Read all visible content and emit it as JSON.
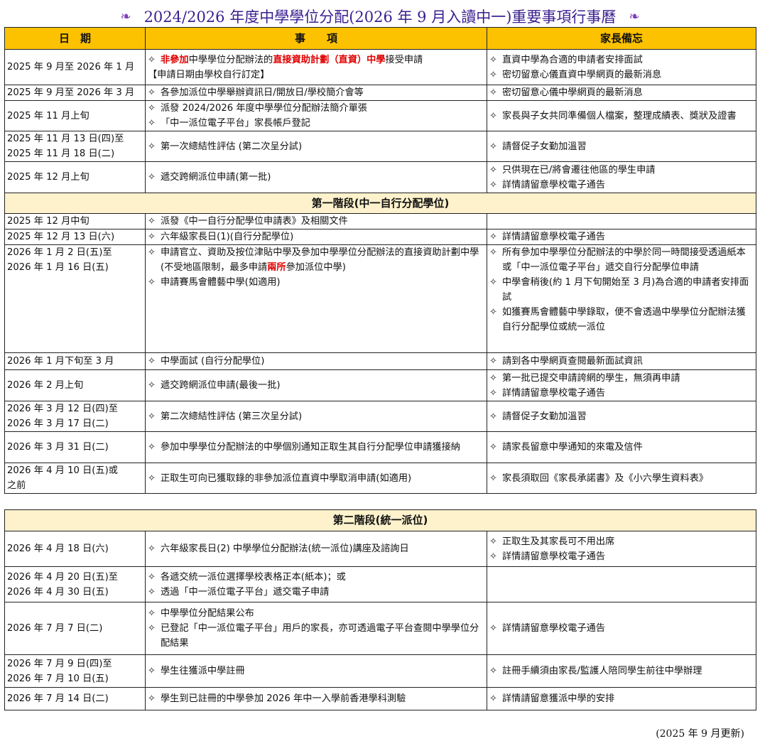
{
  "title": "2024/2026 年度中學學位分配(2026 年 9 月入讀中一)重要事項行事曆",
  "ornament_left": "ঌ",
  "ornament_right": "ঌ",
  "header": {
    "date": "日　期",
    "item": "事　　項",
    "note": "家長備忘"
  },
  "bullet": "✧",
  "rows1": [
    {
      "date": "2025 年 9 月至 2026 年 1 月",
      "items": [
        {
          "parts": [
            {
              "t": "非參加",
              "c": "red"
            },
            {
              "t": "中學學位分配辦法的"
            },
            {
              "t": "直接資助計劃（直資）中學",
              "c": "red"
            },
            {
              "t": "接受申請"
            }
          ]
        },
        {
          "nobullet": true,
          "parts": [
            {
              "t": "【申請日期由學校自行訂定】"
            }
          ]
        }
      ],
      "notes": [
        "直資中學為合適的申請者安排面試",
        "密切留意心儀直資中學網頁的最新消息"
      ]
    },
    {
      "date": "2025 年 9 月至 2026 年 3 月",
      "items": [
        {
          "parts": [
            {
              "t": "各參加派位中學舉辦資訊日/開放日/學校簡介會等"
            }
          ]
        }
      ],
      "notes": [
        "密切留意心儀中學網頁的最新消息"
      ]
    },
    {
      "date": "2025 年 11 月上旬",
      "items": [
        {
          "parts": [
            {
              "t": "派發 2024/2026 年度中學學位分配辦法簡介單張"
            }
          ]
        },
        {
          "parts": [
            {
              "t": "「中一派位電子平台」家長帳戶登記"
            }
          ]
        }
      ],
      "notes": [
        "家長與子女共同準備個人檔案，整理成績表、獎狀及證書"
      ]
    },
    {
      "date": "2025 年 11 月 13 日(四)至\n2025 年 11 月 18 日(二)",
      "items": [
        {
          "parts": [
            {
              "t": "第一次總結性評估 (第二次呈分試)"
            }
          ]
        }
      ],
      "notes": [
        "請督促子女勤加溫習"
      ]
    },
    {
      "date": "2025 年 12 月上旬",
      "items": [
        {
          "parts": [
            {
              "t": "遞交跨網派位申請(第一批)"
            }
          ]
        }
      ],
      "notes": [
        "只供現在已/將會遷往他區的學生申請",
        "詳情請留意學校電子通告"
      ]
    }
  ],
  "stage1": "第一階段(中一自行分配學位)",
  "rows2": [
    {
      "date": "2025 年 12 月中旬",
      "items": [
        {
          "parts": [
            {
              "t": "派發《中一自行分配學位申請表》及相關文件"
            }
          ]
        }
      ],
      "notes": []
    },
    {
      "date": "2025 年 12 月 13 日(六)",
      "items": [
        {
          "parts": [
            {
              "t": "六年級家長日(1)(自行分配學位)"
            }
          ]
        }
      ],
      "notes": [
        "詳情請留意學校電子通告"
      ]
    },
    {
      "date": "2026 年 1 月 2 日(五)至\n2026 年 1 月 16 日(五)",
      "top": true,
      "items": [
        {
          "parts": [
            {
              "t": "申請官立、資助及按位津貼中學及參加中學學位分配辦法的直接資助計劃中學(不受地區限制，最多申請"
            },
            {
              "t": "兩所",
              "c": "red"
            },
            {
              "t": "參加派位中學)"
            }
          ]
        },
        {
          "parts": [
            {
              "t": "申請賽馬會體藝中學(如適用)"
            }
          ]
        }
      ],
      "notes": [
        "所有參加中學學位分配辦法的中學於同一時間接受透過紙本或「中一派位電子平台」遞交自行分配學位申請",
        "中學會稍後(約 1 月下旬開始至 3 月)為合適的申請者安排面試",
        "如獲賽馬會體藝中學錄取，便不會透過中學學位分配辦法獲自行分配學位或統一派位"
      ]
    },
    {
      "date": "2026 年 1 月下旬至 3 月",
      "items": [
        {
          "parts": [
            {
              "t": "中學面試 (自行分配學位)"
            }
          ]
        }
      ],
      "notes": [
        "請到各中學網頁查閱最新面試資訊"
      ]
    },
    {
      "date": "2026 年 2 月上旬",
      "items": [
        {
          "parts": [
            {
              "t": "遞交跨網派位申請(最後一批)"
            }
          ]
        }
      ],
      "notes": [
        "第一批已提交申請誇網的學生，無須再申請",
        "詳情請留意學校電子通告"
      ]
    },
    {
      "date": "2026 年 3 月 12 日(四)至\n2026 年 3 月 17 日(二)",
      "items": [
        {
          "parts": [
            {
              "t": "第二次總結性評估 (第三次呈分試)"
            }
          ]
        }
      ],
      "notes": [
        "請督促子女勤加溫習"
      ]
    },
    {
      "date": "2026 年 3 月 31  日(二)",
      "items": [
        {
          "parts": [
            {
              "t": "參加中學學位分配辦法的中學個別通知正取生其自行分配學位申請獲接納"
            }
          ]
        }
      ],
      "notes": [
        "請家長留意中學通知的來電及信件"
      ]
    },
    {
      "date": "2026 年 4 月 10 日(五)或\n之前",
      "items": [
        {
          "parts": [
            {
              "t": "正取生可向已獲取錄的非參加派位直資中學取消申請(如適用)"
            }
          ]
        }
      ],
      "notes": [
        "家長須取回《家長承諾書》及《小六學生資料表》"
      ]
    }
  ],
  "stage2": "第二階段(統一派位)",
  "rows3": [
    {
      "date": "2026 年 4 月 18 日(六)",
      "items": [
        {
          "parts": [
            {
              "t": "六年級家長日(2) 中學學位分配辦法(統一派位)講座及諮詢日"
            }
          ]
        }
      ],
      "notes": [
        "正取生及其家長可不用出席",
        "詳情請留意學校電子通告"
      ]
    },
    {
      "date": "2026 年 4 月 20 日(五)至\n2026 年 4 月 30 日(五)",
      "items": [
        {
          "parts": [
            {
              "t": "各遞交統一派位選擇學校表格正本(紙本)；或"
            }
          ]
        },
        {
          "parts": [
            {
              "t": "透過「中一派位電子平台」遞交電子申請"
            }
          ]
        }
      ],
      "notes": []
    },
    {
      "date": "2026 年 7 月 7 日(二)",
      "items": [
        {
          "parts": [
            {
              "t": "中學學位分配結果公布"
            }
          ]
        },
        {
          "parts": [
            {
              "t": "已登記「中一派位電子平台」用戶的家長，亦可透過電子平台查閱中學學位分配結果"
            }
          ]
        }
      ],
      "notes": [
        "詳情請留意學校電子通告"
      ]
    },
    {
      "date": "2026 年 7 月 9 日(四)至\n2026 年 7 月 10 日(五)",
      "items": [
        {
          "parts": [
            {
              "t": "學生往獲派中學註冊"
            }
          ]
        }
      ],
      "notes": [
        "註冊手續須由家長/監護人陪同學生前往中學辦理"
      ]
    },
    {
      "date": "2026 年 7 月 14 日(二)",
      "items": [
        {
          "parts": [
            {
              "t": "學生到已註冊的中學參加 2026 年中一入學前香港學科測驗"
            }
          ]
        }
      ],
      "notes": [
        "詳情請留意獲派中學的安排"
      ]
    }
  ],
  "footer": "(2025 年 9 月更新)"
}
